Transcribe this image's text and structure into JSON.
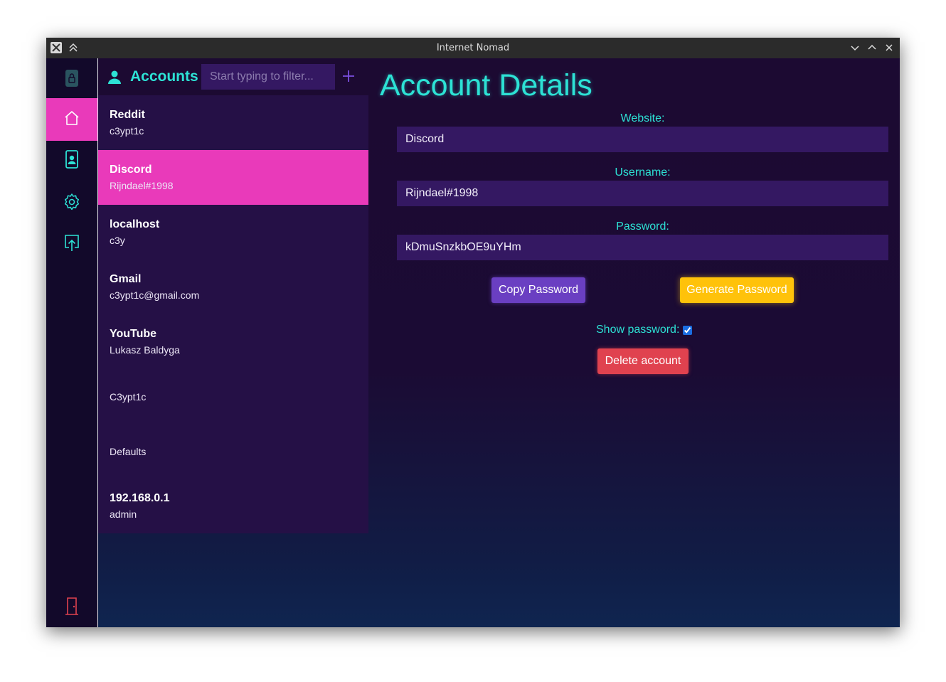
{
  "window": {
    "title": "Internet Nomad"
  },
  "nav": {
    "items": [
      "lock",
      "home",
      "contacts",
      "settings",
      "export",
      "exit"
    ],
    "active": "home"
  },
  "accounts_panel": {
    "title": "Accounts",
    "filter_placeholder": "Start typing to filter...",
    "filter_value": "",
    "items": [
      {
        "website": "Reddit",
        "username": "c3ypt1c"
      },
      {
        "website": "Discord",
        "username": "Rijndael#1998"
      },
      {
        "website": "localhost",
        "username": "c3y"
      },
      {
        "website": "Gmail",
        "username": "c3ypt1c@gmail.com"
      },
      {
        "website": "YouTube",
        "username": "Lukasz Baldyga"
      },
      {
        "website": "",
        "username": "C3ypt1c"
      },
      {
        "website": "",
        "username": "Defaults"
      },
      {
        "website": "192.168.0.1",
        "username": "admin"
      }
    ],
    "selected_index": 1
  },
  "details": {
    "title": "Account Details",
    "website_label": "Website:",
    "website_value": "Discord",
    "username_label": "Username:",
    "username_value": "Rijndael#1998",
    "password_label": "Password:",
    "password_value": "kDmuSnzkbOE9uYHm",
    "copy_label": "Copy Password",
    "generate_label": "Generate Password",
    "show_password_label": "Show password:",
    "show_password_checked": true,
    "delete_label": "Delete account"
  },
  "colors": {
    "accent_pink": "#e93aba",
    "accent_cyan": "#2de2d5",
    "copy_purple": "#6a3fc2",
    "generate_yellow": "#ffc20a",
    "delete_red": "#e0424f"
  }
}
